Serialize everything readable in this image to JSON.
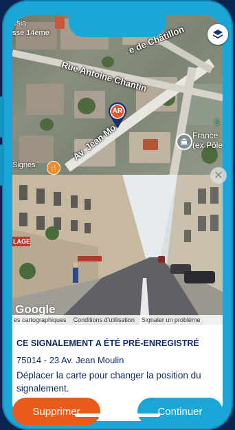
{
  "colors": {
    "frame": "#1aa7d8",
    "primary_text": "#0f2a66",
    "delete_button": "#ea5a1a",
    "continue_button": "#1aa7d8",
    "marker": "#e4572e"
  },
  "map": {
    "streets": {
      "chatillon": "e de Châtillon",
      "antoine_chantin": "Rue Antoine Chantin",
      "jean_moulin": "Av. Jean Mo"
    },
    "places": {
      "top_left_1": "ésia",
      "top_left_2": "sse 14ème",
      "france_1": "France",
      "france_2": "(ex Pôle",
      "signes": "Signes",
      "s_label": "S"
    },
    "marker_label": "AR",
    "icons": {
      "layers": "layers-icon",
      "poi": "government-building-icon",
      "food": "restaurant-icon"
    }
  },
  "street_view": {
    "shop_sign": "LAGE",
    "footer": {
      "map_data": "es cartographiques",
      "terms": "Conditions d'utilisation",
      "report": "Signaler un problème"
    },
    "google_logo": "Google",
    "close_icon": "close-icon"
  },
  "report": {
    "title": "CE SIGNALEMENT A ÉTÉ PRÉ-ENREGISTRÉ",
    "address": "75014 - 23 Av. Jean Moulin",
    "hint": "Déplacer la carte pour changer la position du signalement."
  },
  "buttons": {
    "delete": "Supprimer",
    "continue": "Continuer"
  }
}
